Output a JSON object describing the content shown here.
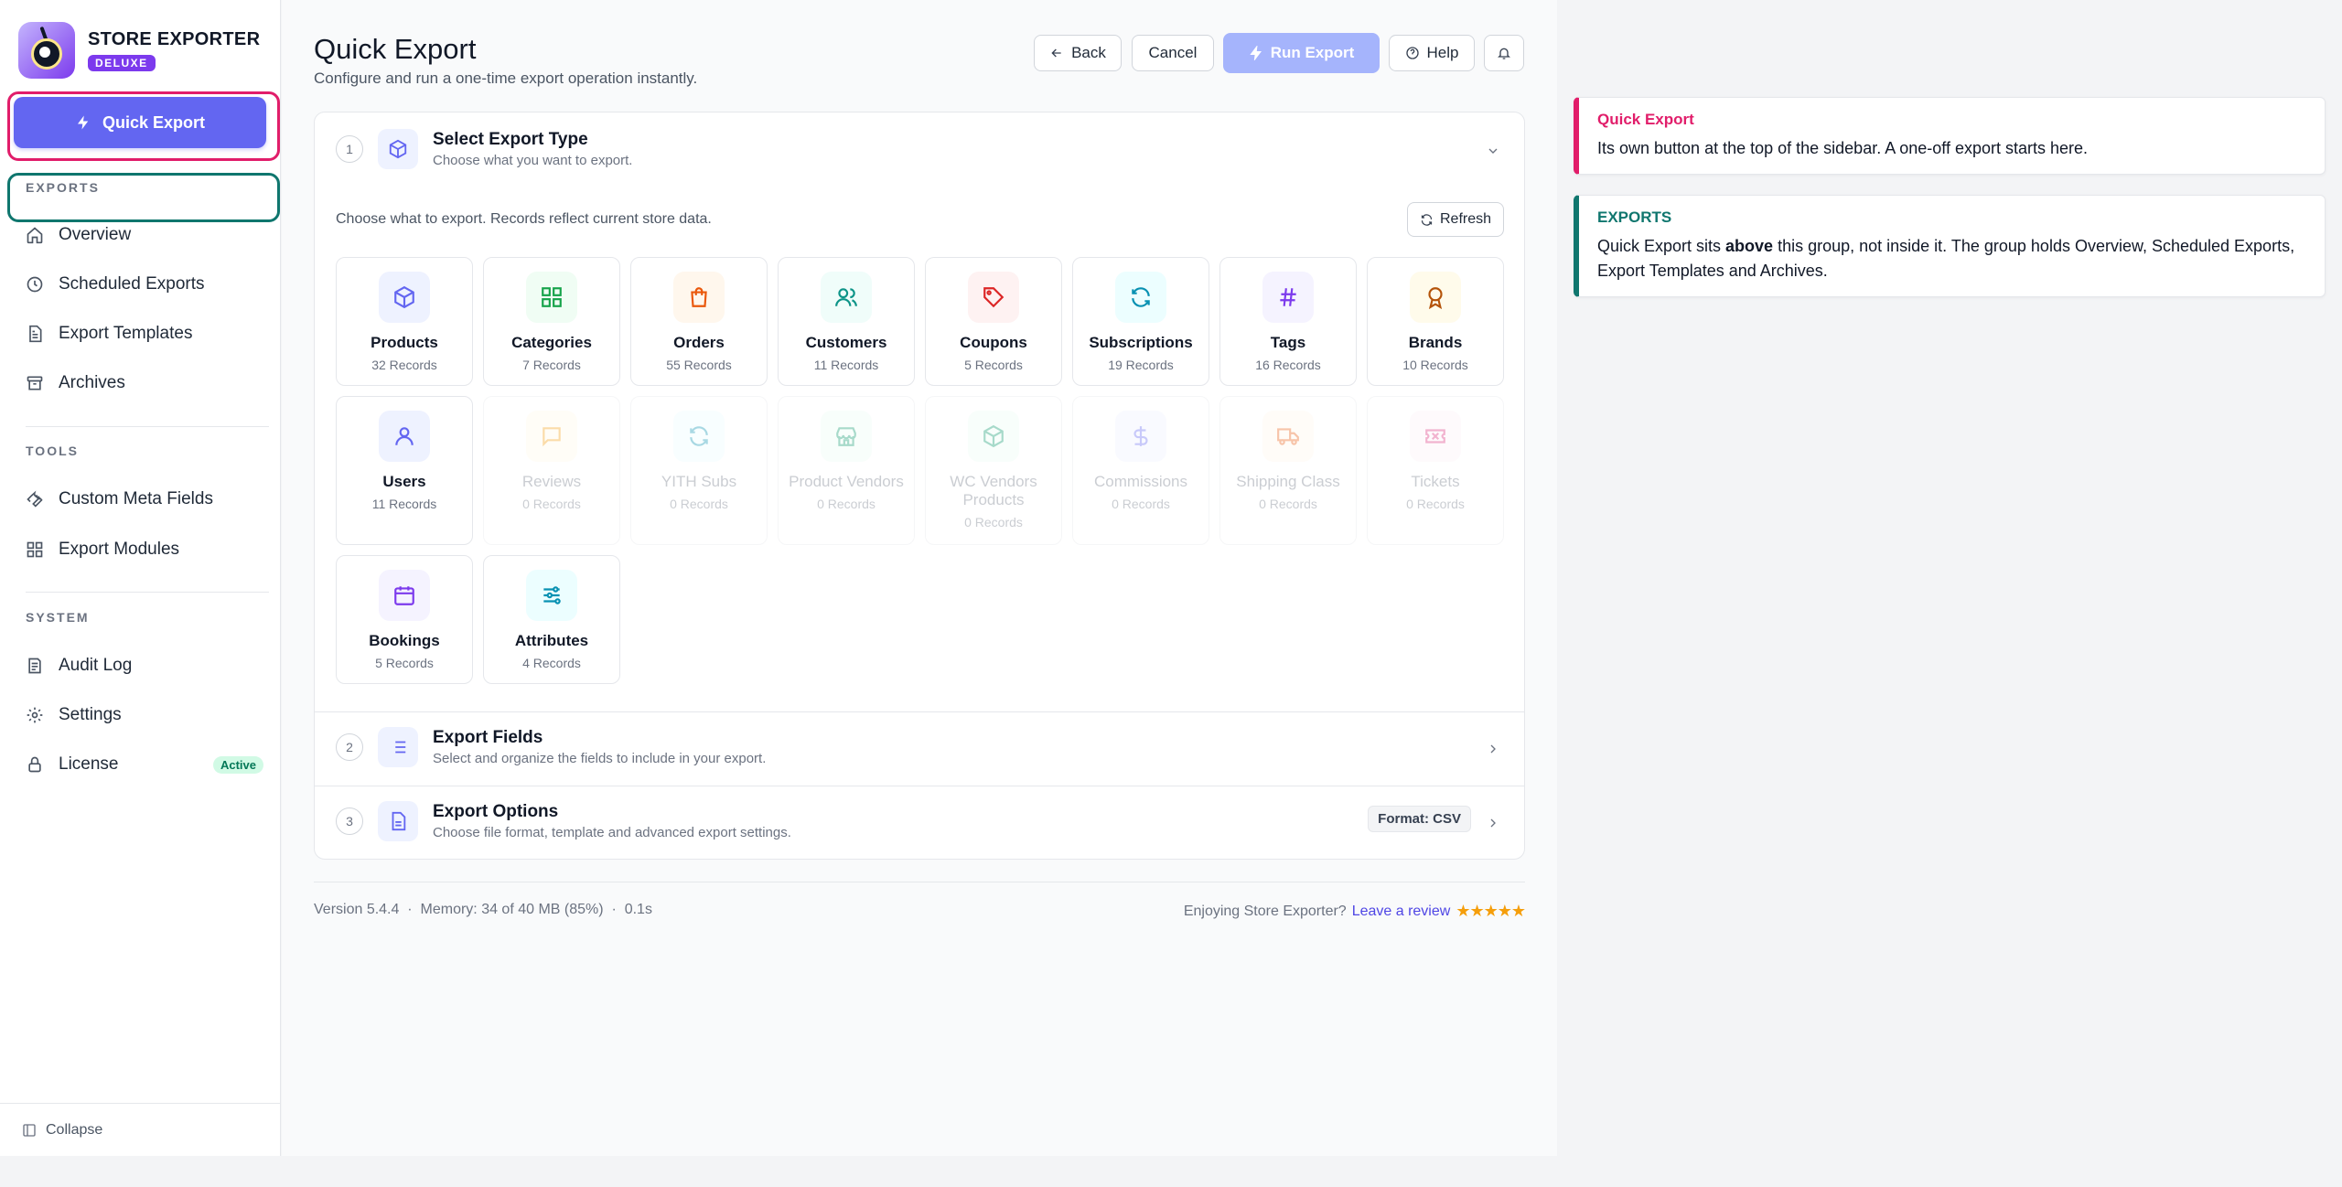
{
  "brand": {
    "name": "STORE EXPORTER",
    "badge": "DELUXE"
  },
  "sidebar": {
    "quick_export": "Quick Export",
    "sections": {
      "exports": "EXPORTS",
      "tools": "TOOLS",
      "system": "SYSTEM"
    },
    "exports_items": [
      "Overview",
      "Scheduled Exports",
      "Export Templates",
      "Archives"
    ],
    "tools_items": [
      "Custom Meta Fields",
      "Export Modules"
    ],
    "system_items": [
      "Audit Log",
      "Settings",
      "License"
    ],
    "license_badge": "Active",
    "collapse": "Collapse"
  },
  "header": {
    "title": "Quick Export",
    "subtitle": "Configure and run a one-time export operation instantly.",
    "back": "Back",
    "cancel": "Cancel",
    "run": "Run Export",
    "help": "Help"
  },
  "steps": {
    "s1": {
      "num": "1",
      "title": "Select Export Type",
      "sub": "Choose what you want to export."
    },
    "s2": {
      "num": "2",
      "title": "Export Fields",
      "sub": "Select and organize the fields to include in your export."
    },
    "s3": {
      "num": "3",
      "title": "Export Options",
      "sub": "Choose file format, template and advanced export settings."
    }
  },
  "select_type": {
    "intro": "Choose what to export. Records reflect current store data.",
    "refresh": "Refresh",
    "tiles": [
      {
        "name": "Products",
        "count": "32 Records",
        "icon": "box-icon",
        "color": "#6366f1",
        "bg": "#eef2ff",
        "enabled": true
      },
      {
        "name": "Categories",
        "count": "7 Records",
        "icon": "grid-icon",
        "color": "#16a34a",
        "bg": "#f0fdf4",
        "enabled": true
      },
      {
        "name": "Orders",
        "count": "55 Records",
        "icon": "bag-icon",
        "color": "#ea580c",
        "bg": "#fff7ed",
        "enabled": true
      },
      {
        "name": "Customers",
        "count": "11 Records",
        "icon": "users-icon",
        "color": "#0d9488",
        "bg": "#f0fdfa",
        "enabled": true
      },
      {
        "name": "Coupons",
        "count": "5 Records",
        "icon": "tag-icon",
        "color": "#dc2626",
        "bg": "#fef2f2",
        "enabled": true
      },
      {
        "name": "Subscriptions",
        "count": "19 Records",
        "icon": "refresh-icon",
        "color": "#0891b2",
        "bg": "#ecfeff",
        "enabled": true
      },
      {
        "name": "Tags",
        "count": "16 Records",
        "icon": "hash-icon",
        "color": "#7c3aed",
        "bg": "#f5f3ff",
        "enabled": true
      },
      {
        "name": "Brands",
        "count": "10 Records",
        "icon": "award-icon",
        "color": "#b45309",
        "bg": "#fffbeb",
        "enabled": true
      },
      {
        "name": "Users",
        "count": "11 Records",
        "icon": "user-icon",
        "color": "#6366f1",
        "bg": "#eef2ff",
        "enabled": true
      },
      {
        "name": "Reviews",
        "count": "0 Records",
        "icon": "message-icon",
        "color": "#f59e0b",
        "bg": "#fffbeb",
        "enabled": false
      },
      {
        "name": "YITH Subs",
        "count": "0 Records",
        "icon": "refresh-icon",
        "color": "#0891b2",
        "bg": "#ecfeff",
        "enabled": false
      },
      {
        "name": "Product Vendors",
        "count": "0 Records",
        "icon": "store-icon",
        "color": "#059669",
        "bg": "#ecfdf5",
        "enabled": false
      },
      {
        "name": "WC Vendors Products",
        "count": "0 Records",
        "icon": "box-icon",
        "color": "#059669",
        "bg": "#ecfdf5",
        "enabled": false
      },
      {
        "name": "Commissions",
        "count": "0 Records",
        "icon": "dollar-icon",
        "color": "#6366f1",
        "bg": "#eef2ff",
        "enabled": false
      },
      {
        "name": "Shipping Class",
        "count": "0 Records",
        "icon": "truck-icon",
        "color": "#ea580c",
        "bg": "#fff7ed",
        "enabled": false
      },
      {
        "name": "Tickets",
        "count": "0 Records",
        "icon": "ticket-icon",
        "color": "#db2777",
        "bg": "#fdf2f8",
        "enabled": false
      },
      {
        "name": "Bookings",
        "count": "5 Records",
        "icon": "calendar-icon",
        "color": "#7c3aed",
        "bg": "#f5f3ff",
        "enabled": true
      },
      {
        "name": "Attributes",
        "count": "4 Records",
        "icon": "sliders-icon",
        "color": "#0891b2",
        "bg": "#ecfeff",
        "enabled": true
      }
    ]
  },
  "options": {
    "format_badge": "Format: CSV"
  },
  "footer": {
    "version": "Version 5.4.4",
    "memory": "Memory: 34 of 40 MB (85%)",
    "time": "0.1s",
    "enjoy": "Enjoying Store Exporter?",
    "review": "Leave a review",
    "stars": "★★★★★"
  },
  "notes": {
    "qe": {
      "title": "Quick Export",
      "body": "Its own button at the top of the sidebar. A one-off export starts here.",
      "color": "#e11d6a"
    },
    "ex": {
      "title": "EXPORTS",
      "body_pre": "Quick Export sits ",
      "body_bold": "above",
      "body_post": " this group, not inside it. The group holds Overview, Scheduled Exports, Export Templates and Archives.",
      "color": "#0f766e"
    }
  }
}
